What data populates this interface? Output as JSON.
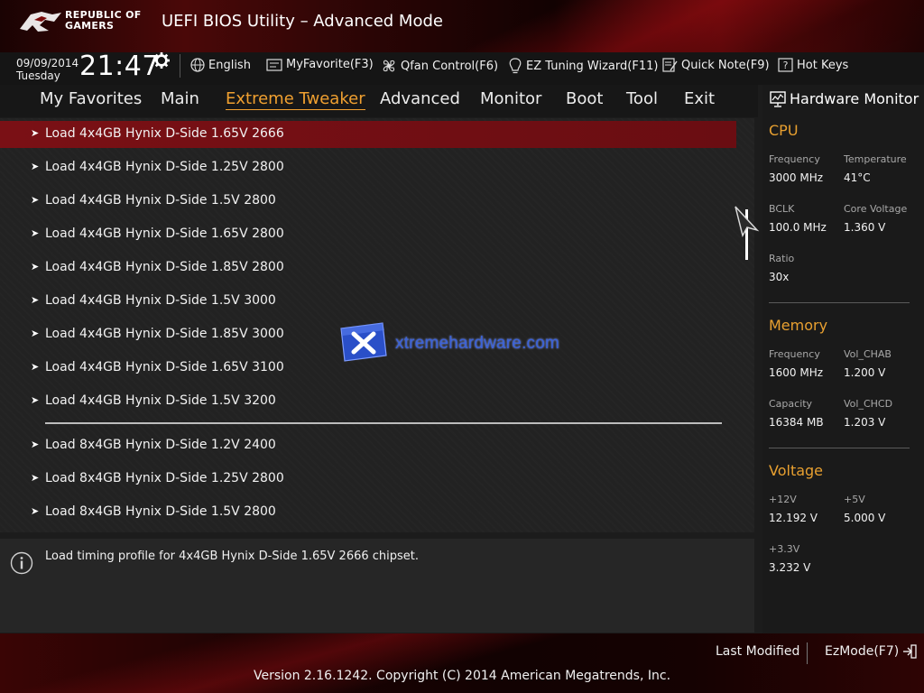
{
  "header": {
    "brand_line1": "REPUBLIC OF",
    "brand_line2": "GAMERS",
    "title": "UEFI BIOS Utility – Advanced Mode"
  },
  "status": {
    "date": "09/09/2014",
    "day": "Tuesday",
    "time": "21:47",
    "items": [
      {
        "label": "English",
        "icon": "globe-icon"
      },
      {
        "label": "MyFavorite(F3)",
        "icon": "favorite-icon"
      },
      {
        "label": "Qfan Control(F6)",
        "icon": "fan-icon"
      },
      {
        "label": "EZ Tuning Wizard(F11)",
        "icon": "lightbulb-icon"
      },
      {
        "label": "Quick Note(F9)",
        "icon": "note-icon"
      },
      {
        "label": "Hot Keys",
        "icon": "help-key-icon"
      }
    ]
  },
  "tabs": [
    {
      "label": "My Favorites",
      "active": false
    },
    {
      "label": "Main",
      "active": false
    },
    {
      "label": "Extreme Tweaker",
      "active": true
    },
    {
      "label": "Advanced",
      "active": false
    },
    {
      "label": "Monitor",
      "active": false
    },
    {
      "label": "Boot",
      "active": false
    },
    {
      "label": "Tool",
      "active": false
    },
    {
      "label": "Exit",
      "active": false
    }
  ],
  "items": [
    {
      "label": "Load 4x4GB Hynix D-Side 1.65V 2666",
      "selected": true
    },
    {
      "label": "Load 4x4GB Hynix D-Side 1.25V 2800"
    },
    {
      "label": "Load 4x4GB Hynix D-Side 1.5V 2800"
    },
    {
      "label": "Load 4x4GB Hynix D-Side 1.65V 2800"
    },
    {
      "label": "Load 4x4GB Hynix D-Side 1.85V 2800"
    },
    {
      "label": "Load 4x4GB Hynix D-Side 1.5V 3000"
    },
    {
      "label": "Load 4x4GB Hynix D-Side 1.85V 3000"
    },
    {
      "label": "Load 4x4GB Hynix D-Side 1.65V 3100"
    },
    {
      "label": "Load 4x4GB Hynix D-Side 1.5V 3200"
    },
    {
      "label": "Load 8x4GB Hynix D-Side 1.2V 2400"
    },
    {
      "label": "Load 8x4GB Hynix D-Side 1.25V 2800"
    },
    {
      "label": "Load 8x4GB Hynix D-Side 1.5V 2800"
    }
  ],
  "watermark": {
    "text": "xtremehardware.com"
  },
  "help": {
    "text": "Load timing profile for 4x4GB Hynix D-Side 1.65V 2666 chipset."
  },
  "hw": {
    "title": "Hardware Monitor",
    "cpu": {
      "heading": "CPU",
      "frequency_label": "Frequency",
      "frequency": "3000 MHz",
      "temperature_label": "Temperature",
      "temperature": "41°C",
      "bclk_label": "BCLK",
      "bclk": "100.0 MHz",
      "core_voltage_label": "Core Voltage",
      "core_voltage": "1.360 V",
      "ratio_label": "Ratio",
      "ratio": "30x"
    },
    "memory": {
      "heading": "Memory",
      "frequency_label": "Frequency",
      "frequency": "1600 MHz",
      "vol_chab_label": "Vol_CHAB",
      "vol_chab": "1.200 V",
      "capacity_label": "Capacity",
      "capacity": "16384 MB",
      "vol_chcd_label": "Vol_CHCD",
      "vol_chcd": "1.203 V"
    },
    "voltage": {
      "heading": "Voltage",
      "v12_label": "+12V",
      "v12": "12.192 V",
      "v5_label": "+5V",
      "v5": "5.000 V",
      "v33_label": "+3.3V",
      "v33": "3.232 V"
    }
  },
  "footer": {
    "last_modified": "Last Modified",
    "ezmode": "EzMode(F7)",
    "version": "Version 2.16.1242. Copyright (C) 2014 American Megatrends, Inc."
  },
  "colors": {
    "accent": "#e8a030",
    "selected_row": "#7a1015",
    "header_red": "#5a0a0c"
  }
}
